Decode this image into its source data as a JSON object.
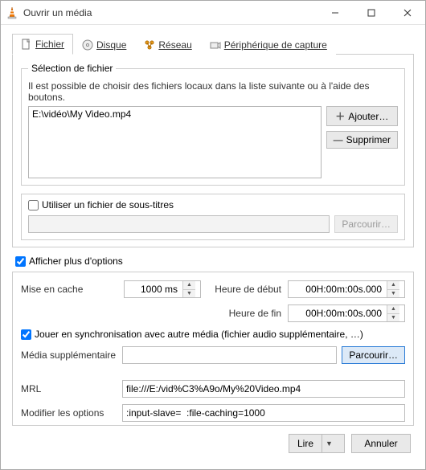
{
  "window": {
    "title": "Ouvrir un média"
  },
  "tabs": {
    "file": "Fichier",
    "disc": "Disque",
    "network": "Réseau",
    "capture": "Périphérique de capture"
  },
  "selection": {
    "legend": "Sélection de fichier",
    "hint": "Il est possible de choisir des fichiers locaux dans la liste suivante ou à l'aide des boutons.",
    "file": "E:\\vidéo\\My Video.mp4",
    "add_btn": "Ajouter…",
    "del_btn": "Supprimer"
  },
  "subtitles": {
    "checkbox_label": "Utiliser un fichier de sous-titres",
    "browse_btn": "Parcourir…"
  },
  "show_more": "Afficher plus d'options",
  "options": {
    "cache_label": "Mise en cache",
    "cache_value": "1000 ms",
    "start_label": "Heure de début",
    "start_value": "00H:00m:00s.000",
    "end_label": "Heure de fin",
    "end_value": "00H:00m:00s.000",
    "sync_label": "Jouer en synchronisation avec autre média (fichier audio supplémentaire, …)",
    "extra_media_label": "Média supplémentaire",
    "extra_browse_btn": "Parcourir…",
    "mrl_label": "MRL",
    "mrl_value": "file:///E:/vid%C3%A9o/My%20Video.mp4",
    "edit_opts_label": "Modifier les options",
    "edit_opts_value": ":input-slave=  :file-caching=1000"
  },
  "footer": {
    "play_btn": "Lire",
    "cancel_btn": "Annuler"
  }
}
